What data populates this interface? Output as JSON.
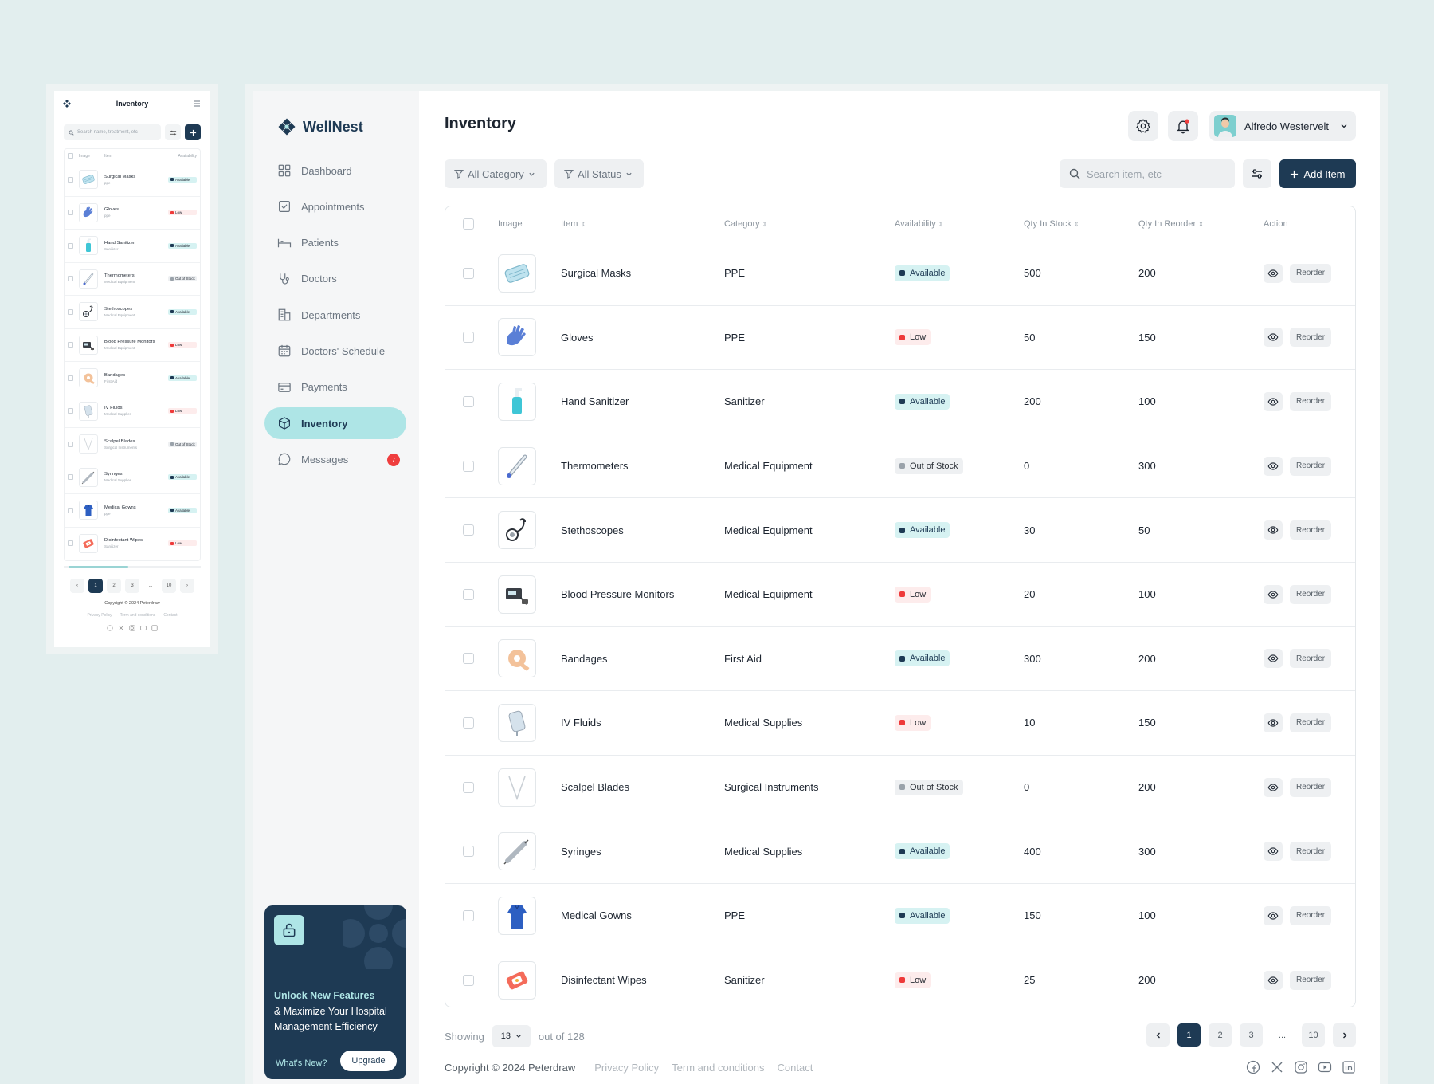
{
  "brand": {
    "name": "WellNest"
  },
  "page": {
    "title": "Inventory"
  },
  "user": {
    "name": "Alfredo Westervelt"
  },
  "nav": [
    {
      "label": "Dashboard",
      "icon": "grid-icon"
    },
    {
      "label": "Appointments",
      "icon": "checkbox-icon"
    },
    {
      "label": "Patients",
      "icon": "bed-icon"
    },
    {
      "label": "Doctors",
      "icon": "stethoscope-icon"
    },
    {
      "label": "Departments",
      "icon": "building-icon"
    },
    {
      "label": "Doctors' Schedule",
      "icon": "calendar-icon"
    },
    {
      "label": "Payments",
      "icon": "card-icon"
    },
    {
      "label": "Inventory",
      "icon": "box-icon",
      "active": true
    },
    {
      "label": "Messages",
      "icon": "chat-icon",
      "badge": "7"
    }
  ],
  "promo": {
    "title": "Unlock New Features",
    "subtitle": "& Maximize Your Hospital Management Efficiency",
    "link": "What's New?",
    "button": "Upgrade"
  },
  "filters": {
    "category": "All Category",
    "status": "All Status"
  },
  "search": {
    "placeholder": "Search item, etc"
  },
  "add_button": "Add Item",
  "table": {
    "headers": [
      "Image",
      "Item",
      "Category",
      "Availability",
      "Qty In Stock",
      "Qty In Reorder",
      "Action"
    ],
    "action_label": "Reorder",
    "rows": [
      {
        "item": "Surgical Masks",
        "category": "PPE",
        "status": "Available",
        "stock": "500",
        "reorder": "200"
      },
      {
        "item": "Gloves",
        "category": "PPE",
        "status": "Low",
        "stock": "50",
        "reorder": "150"
      },
      {
        "item": "Hand Sanitizer",
        "category": "Sanitizer",
        "status": "Available",
        "stock": "200",
        "reorder": "100"
      },
      {
        "item": "Thermometers",
        "category": "Medical Equipment",
        "status": "Out of Stock",
        "stock": "0",
        "reorder": "300"
      },
      {
        "item": "Stethoscopes",
        "category": "Medical Equipment",
        "status": "Available",
        "stock": "30",
        "reorder": "50"
      },
      {
        "item": "Blood Pressure Monitors",
        "category": "Medical Equipment",
        "status": "Low",
        "stock": "20",
        "reorder": "100"
      },
      {
        "item": "Bandages",
        "category": "First Aid",
        "status": "Available",
        "stock": "300",
        "reorder": "200"
      },
      {
        "item": "IV Fluids",
        "category": "Medical Supplies",
        "status": "Low",
        "stock": "10",
        "reorder": "150"
      },
      {
        "item": "Scalpel Blades",
        "category": "Surgical Instruments",
        "status": "Out of Stock",
        "stock": "0",
        "reorder": "200"
      },
      {
        "item": "Syringes",
        "category": "Medical Supplies",
        "status": "Available",
        "stock": "400",
        "reorder": "300"
      },
      {
        "item": "Medical Gowns",
        "category": "PPE",
        "status": "Available",
        "stock": "150",
        "reorder": "100"
      },
      {
        "item": "Disinfectant Wipes",
        "category": "Sanitizer",
        "status": "Low",
        "stock": "25",
        "reorder": "200"
      }
    ]
  },
  "pagination": {
    "showing_label": "Showing",
    "per_page": "13",
    "total_label": "out of 128",
    "pages": [
      "1",
      "2",
      "3",
      "...",
      "10"
    ],
    "current": "1"
  },
  "footer": {
    "copyright": "Copyright © 2024 Peterdraw",
    "links": [
      "Privacy Policy",
      "Term and conditions",
      "Contact"
    ],
    "social": [
      "facebook-icon",
      "x-icon",
      "instagram-icon",
      "youtube-icon",
      "linkedin-icon"
    ]
  },
  "mobile": {
    "title": "Inventory",
    "search_placeholder": "Search name, treatment, etc",
    "headers": [
      "Image",
      "Item",
      "Availability"
    ],
    "rows": [
      {
        "item": "Surgical Masks",
        "category": "ppe",
        "status": "Available"
      },
      {
        "item": "Gloves",
        "category": "ppe",
        "status": "Low"
      },
      {
        "item": "Hand Sanitizer",
        "category": "Sanitizer",
        "status": "Available"
      },
      {
        "item": "Thermometers",
        "category": "Medical Equipment",
        "status": "Out of Stock"
      },
      {
        "item": "Stethoscopes",
        "category": "Medical Equipment",
        "status": "Available"
      },
      {
        "item": "Blood Pressure Monitors",
        "category": "Medical Equipment",
        "status": "Low"
      },
      {
        "item": "Bandages",
        "category": "First Aid",
        "status": "Available"
      },
      {
        "item": "IV Fluids",
        "category": "Medical Supplies",
        "status": "Low"
      },
      {
        "item": "Scalpel Blades",
        "category": "Surgical Instruments",
        "status": "Out of Stock"
      },
      {
        "item": "Syringes",
        "category": "Medical Supplies",
        "status": "Available"
      },
      {
        "item": "Medical Gowns",
        "category": "ppe",
        "status": "Available"
      },
      {
        "item": "Disinfectant Wipes",
        "category": "Sanitizer",
        "status": "Low"
      }
    ],
    "pages": [
      "1",
      "2",
      "3",
      "...",
      "10"
    ],
    "copyright": "Copyright © 2024 Peterdraw",
    "links": [
      "Privacy Policy",
      "Term and conditions",
      "Contact"
    ]
  },
  "colors": {
    "primary": "#1e3a54",
    "accent": "#aee5e6",
    "available": "#1e3a54",
    "low": "#ee3a3a",
    "out_of_stock": "#9aa2aa",
    "background": "#e2eeee"
  }
}
